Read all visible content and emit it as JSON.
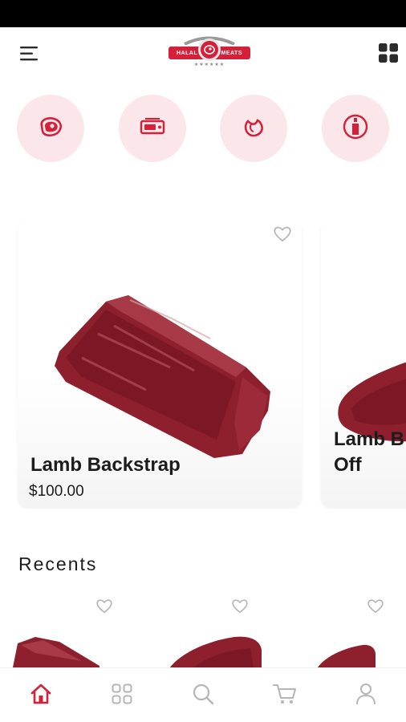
{
  "header": {
    "menu_icon": "hamburger-menu-icon",
    "logo": {
      "left_text": "HALAL",
      "right_text": "MEATS",
      "stars": "★★★★★★"
    },
    "grid_icon": "grid-view-icon"
  },
  "categories": [
    {
      "icon": "steak-icon"
    },
    {
      "icon": "meat-tray-icon"
    },
    {
      "icon": "poultry-icon"
    },
    {
      "icon": "bottle-icon"
    }
  ],
  "featured": [
    {
      "title": "Lamb Backstrap",
      "price": "$100.00",
      "favorite": false
    },
    {
      "title_line1": "Lamb B",
      "title_line2": "Off",
      "favorite": false
    }
  ],
  "recents": {
    "title": "Recents",
    "items": [
      {
        "favorite": false
      },
      {
        "favorite": false
      },
      {
        "favorite": false
      }
    ]
  },
  "bottom_nav": [
    {
      "icon": "home-icon",
      "active": true
    },
    {
      "icon": "categories-icon",
      "active": false
    },
    {
      "icon": "search-icon",
      "active": false
    },
    {
      "icon": "cart-icon",
      "active": false
    },
    {
      "icon": "profile-icon",
      "active": false
    }
  ],
  "colors": {
    "brand": "#d5203a",
    "category_bg": "#fbe7ea",
    "inactive_icon": "#b5b5b5",
    "meat": "#8e1f2c"
  }
}
